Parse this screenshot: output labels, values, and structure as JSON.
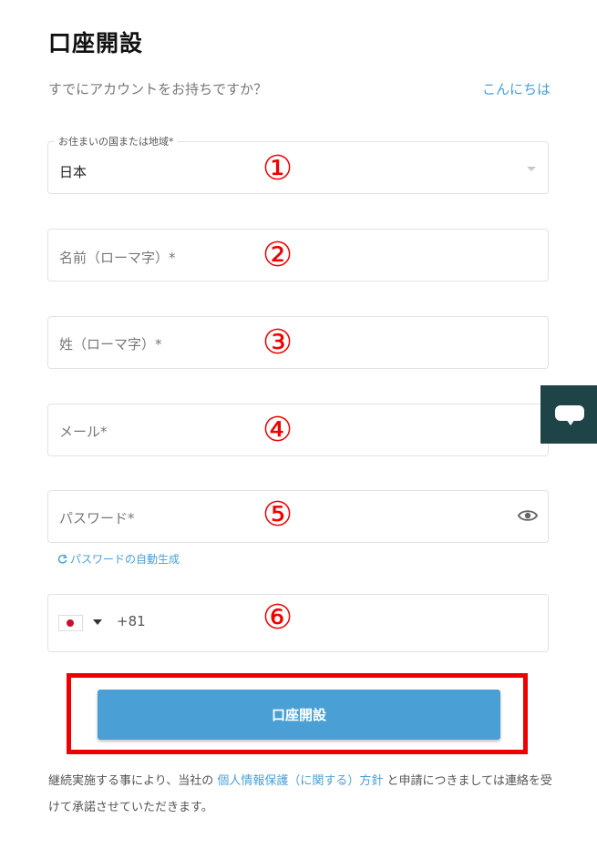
{
  "page": {
    "title": "口座開設",
    "subtitle": "すでにアカウントをお持ちですか？",
    "login_link": "こんにちは"
  },
  "country": {
    "label": "お住まいの国または地域*",
    "value": "日本"
  },
  "first_name": {
    "placeholder": "名前（ローマ字）*"
  },
  "last_name": {
    "placeholder": "姓（ローマ字）*"
  },
  "email": {
    "placeholder": "メール*"
  },
  "password": {
    "placeholder": "パスワード*",
    "generate_link": "パスワードの自動生成"
  },
  "phone": {
    "country_code": "+81",
    "flag": "japan-flag-icon"
  },
  "annotations": [
    "①",
    "②",
    "③",
    "④",
    "⑤",
    "⑥"
  ],
  "submit": {
    "label": "口座開設"
  },
  "footer": {
    "text_before": "継続実施する事により、当社の",
    "policy_link": "個人情報保護（に関する）方針",
    "text_after": "と申請につきましては連絡を受けて承諾させていただきます。"
  },
  "chat": {
    "icon": "chat-bubble-icon"
  },
  "colors": {
    "accent": "#4a9fd4",
    "annotation": "#ee0000",
    "chat_bg": "#1e4447"
  }
}
